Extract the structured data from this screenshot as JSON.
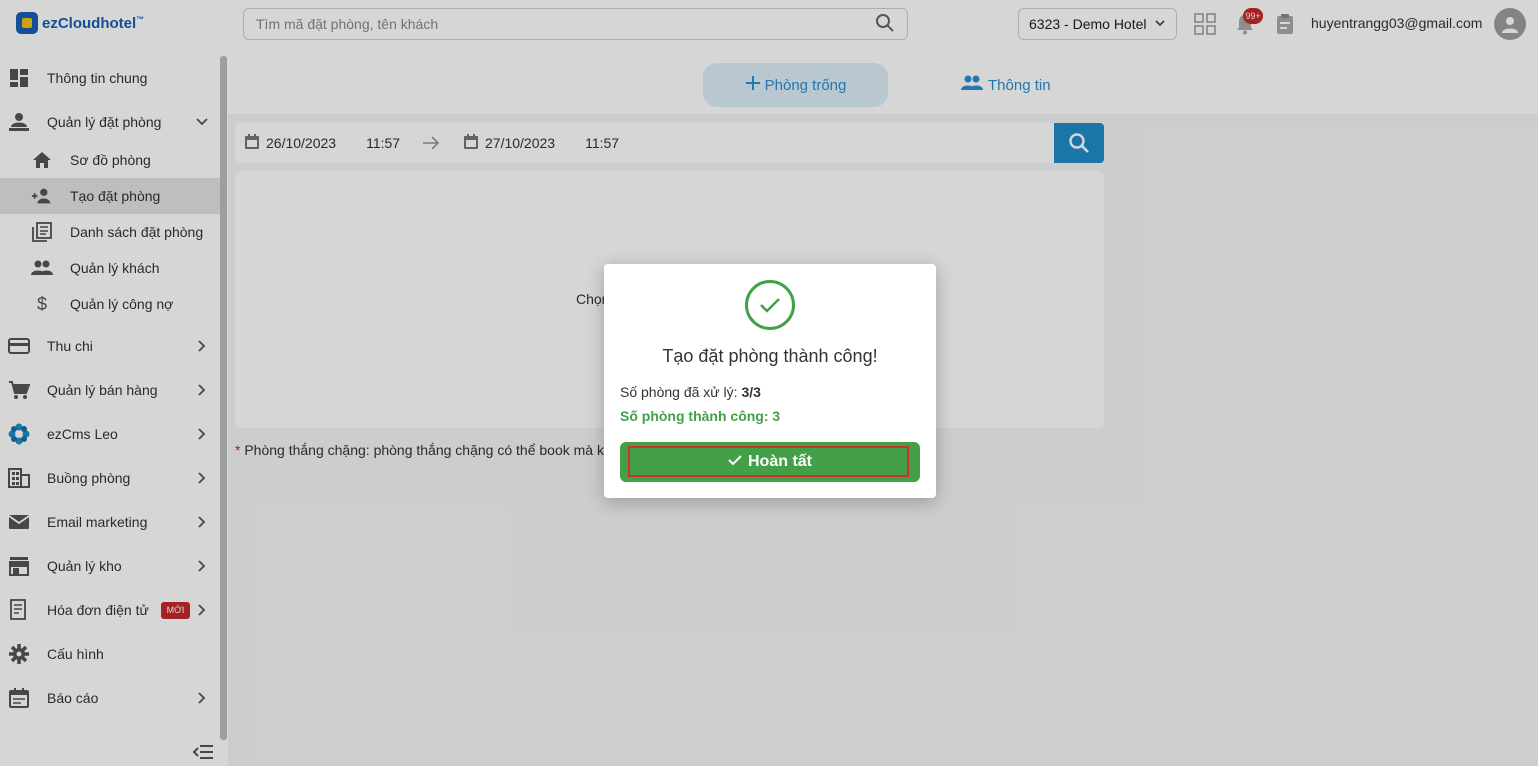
{
  "header": {
    "logo_text": "ezCloudhotel",
    "logo_tm": "™",
    "search_placeholder": "Tìm mã đặt phòng, tên khách",
    "hotel_selected": "6323 - Demo Hotel",
    "notification_count": "99+",
    "user_email": "huyentrangg03@gmail.com"
  },
  "sidebar": {
    "items": [
      {
        "label": "Thông tin chung",
        "icon": "dashboard-icon"
      },
      {
        "label": "Quản lý đặt phòng",
        "icon": "reception-icon"
      },
      {
        "label": "Sơ đồ phòng",
        "icon": "home-icon"
      },
      {
        "label": "Tạo đặt phòng",
        "icon": "add-group-icon"
      },
      {
        "label": "Danh sách đặt phòng",
        "icon": "list-icon"
      },
      {
        "label": "Quản lý khách",
        "icon": "people-icon"
      },
      {
        "label": "Quản lý công nợ",
        "icon": "dollar-icon"
      },
      {
        "label": "Thu chi",
        "icon": "card-icon"
      },
      {
        "label": "Quản lý bán hàng",
        "icon": "cart-icon"
      },
      {
        "label": "ezCms Leo",
        "icon": "flower-icon"
      },
      {
        "label": "Buồng phòng",
        "icon": "building-icon"
      },
      {
        "label": "Email marketing",
        "icon": "mail-icon"
      },
      {
        "label": "Quản lý kho",
        "icon": "store-icon"
      },
      {
        "label": "Hóa đơn điện tử",
        "icon": "receipt-icon",
        "badge": "MỚI"
      },
      {
        "label": "Cấu hình",
        "icon": "gear-icon"
      },
      {
        "label": "Báo cáo",
        "icon": "calendar-report-icon"
      }
    ]
  },
  "tabs": [
    {
      "label": "Phòng trống",
      "icon": "plus-icon"
    },
    {
      "label": "Thông tin",
      "icon": "people-icon"
    }
  ],
  "date_range": {
    "from_date": "26/10/2023",
    "from_time": "11:57",
    "to_date": "27/10/2023",
    "to_time": "11:57"
  },
  "card": {
    "text_visible": "Chọn"
  },
  "note": {
    "star": "*",
    "text": "Phòng thắng chặng: phòng thắng chặng có thể book mà kh"
  },
  "modal": {
    "title": "Tạo đặt phòng thành công!",
    "processed_label": "Số phòng đã xử lý:",
    "processed_value": "3/3",
    "success_label": "Số phòng thành công:",
    "success_value": "3",
    "done_label": "Hoàn tất"
  },
  "colors": {
    "accent_blue": "#2a8fd1",
    "search_button": "#1f8dc9",
    "success_green": "#43a047",
    "badge_red": "#c62828"
  }
}
